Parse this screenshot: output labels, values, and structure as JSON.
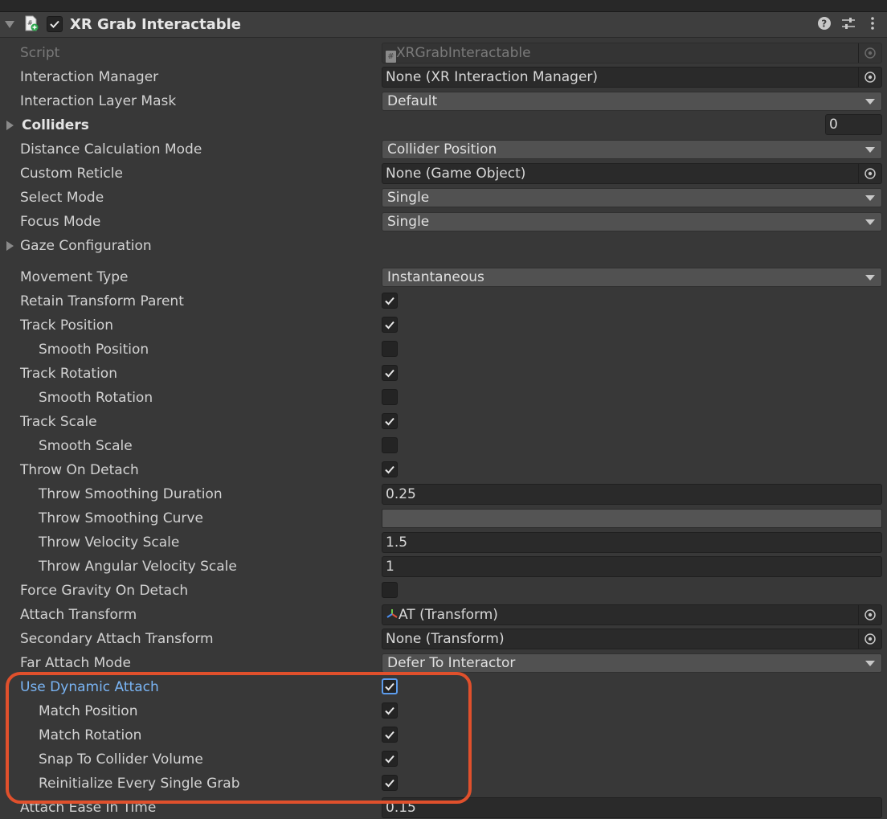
{
  "component": {
    "title": "XR Grab Interactable",
    "enabled": true
  },
  "colors": {
    "panel_bg": "#383838",
    "highlight_border": "#e0502c",
    "active_label": "#7ab5f5"
  },
  "fields": {
    "script": {
      "label": "Script",
      "value": "XRGrabInteractable"
    },
    "interaction_manager": {
      "label": "Interaction Manager",
      "value": "None (XR Interaction Manager)"
    },
    "interaction_layer_mask": {
      "label": "Interaction Layer Mask",
      "value": "Default"
    },
    "colliders": {
      "label": "Colliders",
      "value": "0"
    },
    "distance_calculation_mode": {
      "label": "Distance Calculation Mode",
      "value": "Collider Position"
    },
    "custom_reticle": {
      "label": "Custom Reticle",
      "value": "None (Game Object)"
    },
    "select_mode": {
      "label": "Select Mode",
      "value": "Single"
    },
    "focus_mode": {
      "label": "Focus Mode",
      "value": "Single"
    },
    "gaze_configuration": {
      "label": "Gaze Configuration"
    },
    "movement_type": {
      "label": "Movement Type",
      "value": "Instantaneous"
    },
    "retain_transform_parent": {
      "label": "Retain Transform Parent",
      "checked": true
    },
    "track_position": {
      "label": "Track Position",
      "checked": true
    },
    "smooth_position": {
      "label": "Smooth Position",
      "checked": false
    },
    "track_rotation": {
      "label": "Track Rotation",
      "checked": true
    },
    "smooth_rotation": {
      "label": "Smooth Rotation",
      "checked": false
    },
    "track_scale": {
      "label": "Track Scale",
      "checked": true
    },
    "smooth_scale": {
      "label": "Smooth Scale",
      "checked": false
    },
    "throw_on_detach": {
      "label": "Throw On Detach",
      "checked": true
    },
    "throw_smoothing_duration": {
      "label": "Throw Smoothing Duration",
      "value": "0.25"
    },
    "throw_smoothing_curve": {
      "label": "Throw Smoothing Curve"
    },
    "throw_velocity_scale": {
      "label": "Throw Velocity Scale",
      "value": "1.5"
    },
    "throw_angular_velocity_scale": {
      "label": "Throw Angular Velocity Scale",
      "value": "1"
    },
    "force_gravity_on_detach": {
      "label": "Force Gravity On Detach",
      "checked": false
    },
    "attach_transform": {
      "label": "Attach Transform",
      "value": "AT (Transform)"
    },
    "secondary_attach_transform": {
      "label": "Secondary Attach Transform",
      "value": "None (Transform)"
    },
    "far_attach_mode": {
      "label": "Far Attach Mode",
      "value": "Defer To Interactor"
    },
    "use_dynamic_attach": {
      "label": "Use Dynamic Attach",
      "checked": true
    },
    "match_position": {
      "label": "Match Position",
      "checked": true
    },
    "match_rotation": {
      "label": "Match Rotation",
      "checked": true
    },
    "snap_to_collider_volume": {
      "label": "Snap To Collider Volume",
      "checked": true
    },
    "reinitialize_every_single_grab": {
      "label": "Reinitialize Every Single Grab",
      "checked": true
    },
    "attach_ease_in_time": {
      "label": "Attach Ease In Time",
      "value": "0.15"
    }
  },
  "icons": {
    "header": [
      "foldout-arrow-icon",
      "script-icon",
      "help-icon",
      "presets-icon",
      "menu-icon"
    ],
    "fields": [
      "object-picker-icon",
      "dropdown-arrow-icon",
      "checkmark-icon",
      "transform-axes-icon"
    ]
  }
}
